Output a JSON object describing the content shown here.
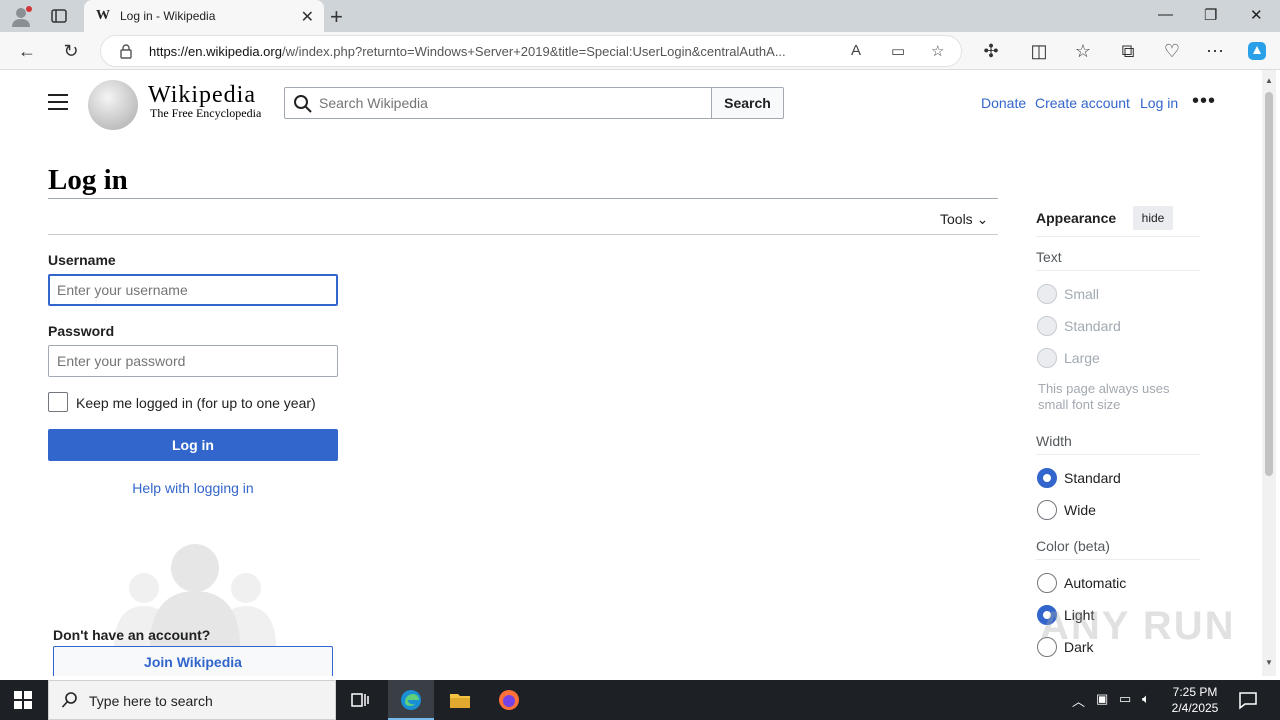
{
  "browser": {
    "tab_title": "Log in - Wikipedia",
    "tab_favicon": "W",
    "url_domain": "https://en.wikipedia.org",
    "url_rest": "/w/index.php?returnto=Windows+Server+2019&title=Special:UserLogin&centralAuthA..."
  },
  "header": {
    "wordmark": "Wikipedia",
    "tagline": "The Free Encyclopedia",
    "search_placeholder": "Search Wikipedia",
    "search_button": "Search",
    "donate": "Donate",
    "create_account": "Create account",
    "log_in": "Log in"
  },
  "main": {
    "heading": "Log in",
    "tools": "Tools",
    "username_label": "Username",
    "username_placeholder": "Enter your username",
    "password_label": "Password",
    "password_placeholder": "Enter your password",
    "remember_label": "Keep me logged in (for up to one year)",
    "login_button": "Log in",
    "help_link": "Help with logging in",
    "no_account": "Don't have an account?",
    "join_button": "Join Wikipedia"
  },
  "appearance": {
    "title": "Appearance",
    "hide": "hide",
    "text_section": "Text",
    "text_options": [
      "Small",
      "Standard",
      "Large"
    ],
    "text_note": "This page always uses small font size",
    "width_section": "Width",
    "width_options": [
      "Standard",
      "Wide"
    ],
    "width_selected": "Standard",
    "color_section": "Color (beta)",
    "color_options": [
      "Automatic",
      "Light",
      "Dark"
    ],
    "color_selected": "Light"
  },
  "watermark": "ANY RUN",
  "taskbar": {
    "search_text": "Type here to search",
    "time": "7:25 PM",
    "date": "2/4/2025"
  },
  "colors": {
    "link": "#3366cc",
    "accent_button": "#3366cc",
    "taskbar": "#1d2126"
  }
}
